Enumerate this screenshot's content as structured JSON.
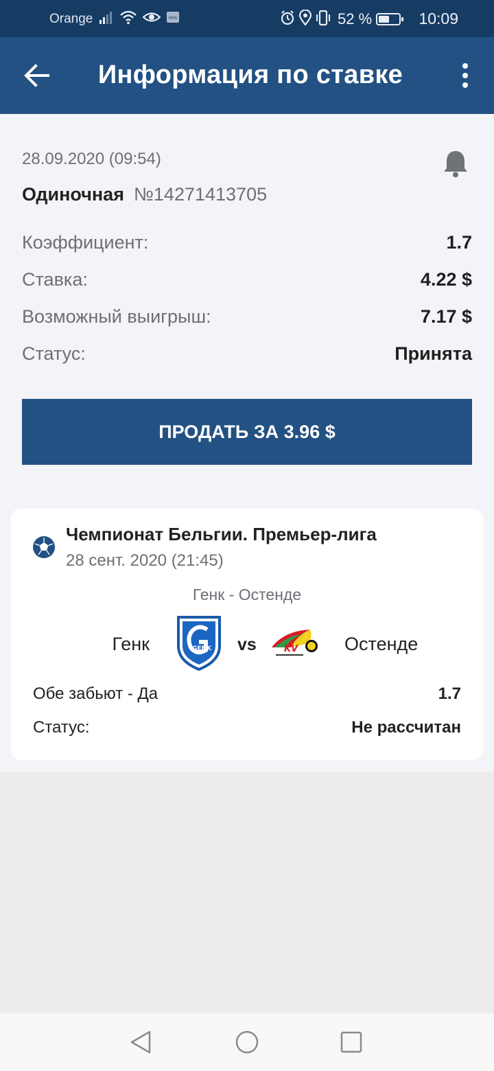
{
  "status_bar": {
    "carrier": "Orange",
    "battery_percent": "52 %",
    "battery_level": 0.52,
    "time": "10:09"
  },
  "app_bar": {
    "title": "Информация по ставке",
    "back_icon": "arrow-left-icon",
    "menu_icon": "more-vert-icon"
  },
  "bet": {
    "datetime": "28.09.2020 (09:54)",
    "type": "Одиночная",
    "number": "№14271413705",
    "notification_icon": "bell-icon",
    "rows": [
      {
        "label": "Коэффициент:",
        "value": "1.7"
      },
      {
        "label": "Ставка:",
        "value": "4.22 $"
      },
      {
        "label": "Возможный выигрыш:",
        "value": "7.17 $"
      },
      {
        "label": "Статус:",
        "value": "Принята"
      }
    ],
    "sell_button": "ПРОДАТЬ ЗА 3.96 $"
  },
  "event": {
    "sport_icon": "football-icon",
    "league": "Чемпионат Бельгии. Премьер-лига",
    "date": "28 сент. 2020 (21:45)",
    "match": "Генк - Остенде",
    "home_team": "Генк",
    "away_team": "Остенде",
    "vs": "vs",
    "home_logo_text": "GENK",
    "away_logo_text": "KV",
    "pick": {
      "label": "Обе забьют - Да",
      "value": "1.7"
    },
    "status": {
      "label": "Статус:",
      "value": "Не рассчитан"
    }
  },
  "colors": {
    "primary": "#235183",
    "status_bar": "#173c64",
    "content_bg": "#f3f4f8",
    "page_bg": "#ececec"
  }
}
